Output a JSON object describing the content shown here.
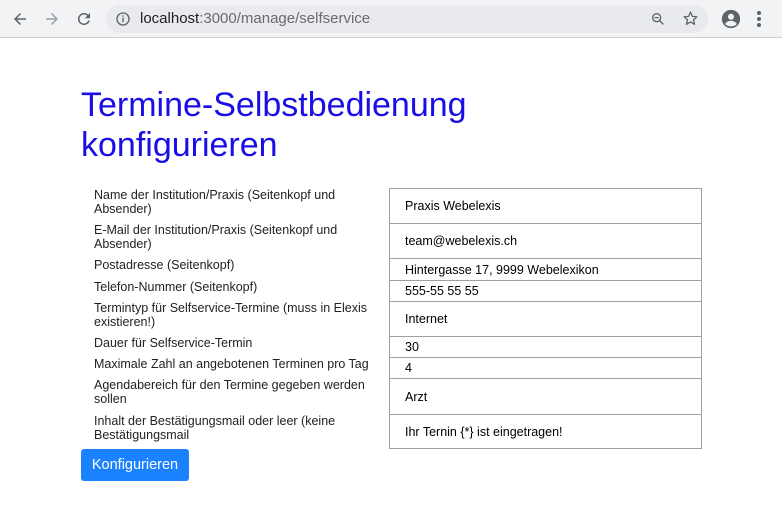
{
  "browser": {
    "url_host": "localhost",
    "url_rest": ":3000/manage/selfservice"
  },
  "page": {
    "title": "Termine-Selbstbedienung konfigurieren",
    "submit_label": "Konfigurieren"
  },
  "form": {
    "rows": [
      {
        "label": "Name der Institution/Praxis (Seitenkopf und Absender)",
        "value": "Praxis Webelexis"
      },
      {
        "label": "E-Mail der Institution/Praxis (Seitenkopf und Absender)",
        "value": "team@webelexis.ch"
      },
      {
        "label": "Postadresse (Seitenkopf)",
        "value": "Hintergasse 17, 9999 Webelexikon"
      },
      {
        "label": "Telefon-Nummer (Seitenkopf)",
        "value": "555-55 55 55"
      },
      {
        "label": "Termintyp für Selfservice-Termine (muss in Elexis existieren!)",
        "value": "Internet"
      },
      {
        "label": "Dauer für Selfservice-Termin",
        "value": "30"
      },
      {
        "label": "Maximale Zahl an angebotenen Terminen pro Tag",
        "value": "4"
      },
      {
        "label": "Agendabereich für den Termine gegeben werden sollen",
        "value": "Arzt"
      },
      {
        "label": "Inhalt der Bestätigungsmail oder leer (keine Bestätigungsmail",
        "value": "Ihr Ternin {*} ist eingetragen!"
      }
    ]
  }
}
